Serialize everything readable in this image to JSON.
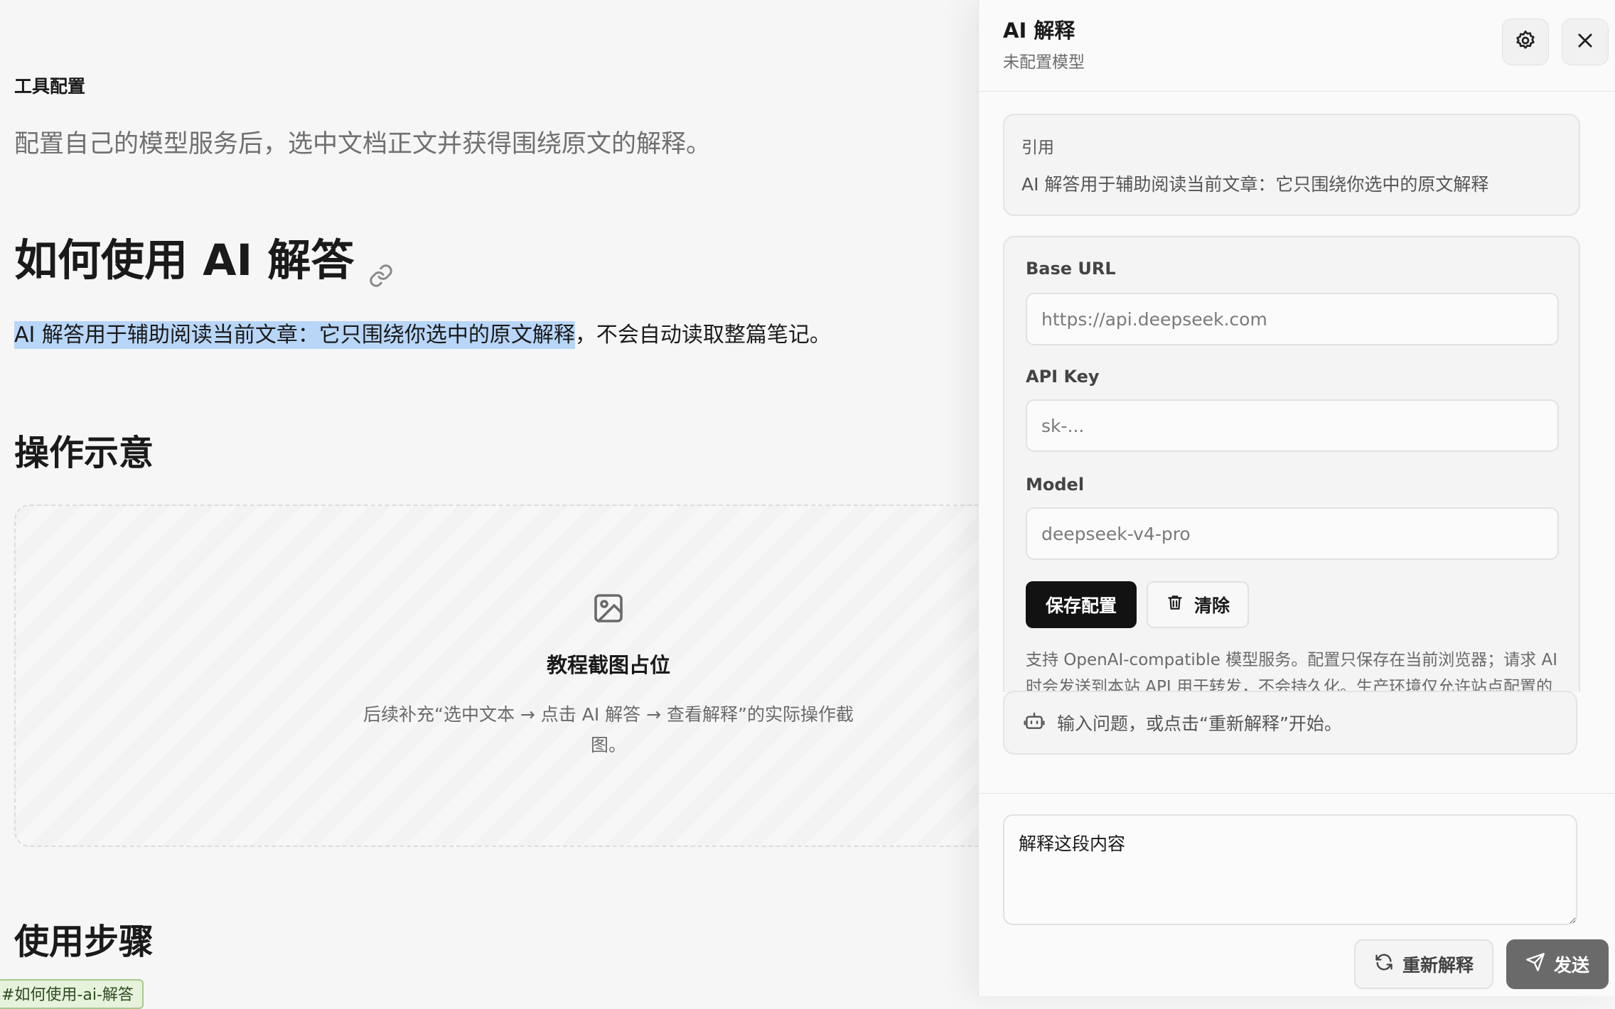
{
  "article": {
    "section_label": "工具配置",
    "intro": "配置自己的模型服务后，选中文档正文并获得围绕原文的解释。",
    "heading": "如何使用 AI 解答",
    "paragraph_selected": "AI 解答用于辅助阅读当前文章：它只围绕你选中的原文解释",
    "paragraph_rest": "，不会自动读取整篇笔记。",
    "demo_heading": "操作示意",
    "placeholder_title": "教程截图占位",
    "placeholder_desc": "后续补充“选中文本 → 点击 AI 解答 → 查看解释”的实际操作截图。",
    "steps_heading": "使用步骤",
    "anchor_tag": "#如何使用-ai-解答"
  },
  "panel": {
    "title": "AI 解释",
    "subtitle": "未配置模型",
    "quote_label": "引用",
    "quote_text": "AI 解答用于辅助阅读当前文章：它只围绕你选中的原文解释",
    "config": {
      "base_url_label": "Base URL",
      "base_url_placeholder": "https://api.deepseek.com",
      "api_key_label": "API Key",
      "api_key_placeholder": "sk-...",
      "model_label": "Model",
      "model_placeholder": "deepseek-v4-pro",
      "save_label": "保存配置",
      "clear_label": "清除",
      "note": "支持 OpenAI-compatible 模型服务。配置只保存在当前浏览器；请求 AI 时会发送到本站 API 用于转发，不会持久化。生产环境仅允许站点配置的"
    },
    "hint": "输入问题，或点击“重新解释”开始。",
    "compose_value": "解释这段内容",
    "regenerate_label": "重新解释",
    "send_label": "发送"
  },
  "icons": {
    "link": "link-icon",
    "image": "image-icon",
    "settings": "gear-icon",
    "close": "close-icon",
    "trash": "trash-icon",
    "bot": "bot-icon",
    "refresh": "refresh-icon",
    "send": "send-icon"
  },
  "colors": {
    "selection": "#b8d6f7",
    "primary_button": "#121212",
    "send_button": "#6a6a6a",
    "anchor_tag_bg": "#e6f2dc"
  }
}
